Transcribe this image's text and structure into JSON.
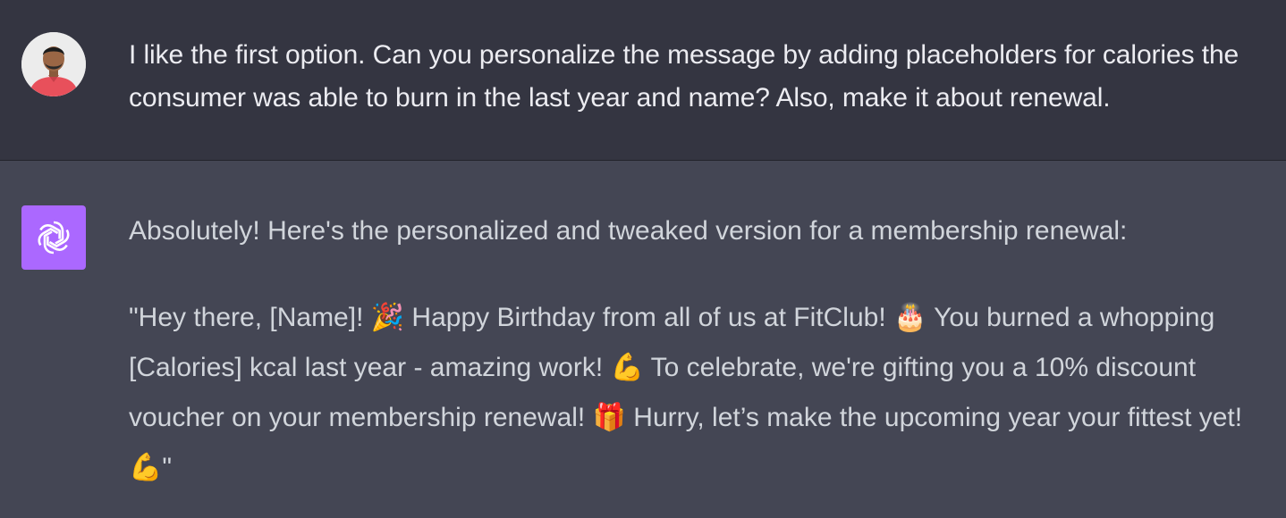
{
  "user_message": {
    "avatar_icon": "user-avatar-photo",
    "text": "I like the first option. Can you personalize the message by adding placeholders for calories the consumer was able to burn in the last year and name? Also, make it about renewal."
  },
  "assistant_message": {
    "avatar_icon": "openai-logo-icon",
    "avatar_color": "#ab68ff",
    "intro": "Absolutely! Here's the personalized and tweaked version for a membership renewal:",
    "body": "\"Hey there, [Name]! 🎉 Happy Birthday from all of us at FitClub! 🎂 You burned a whopping [Calories] kcal last year - amazing work! 💪 To celebrate, we're gifting you a 10% discount voucher on your membership renewal! 🎁 Hurry, let’s make the upcoming year your fittest yet! 💪\""
  },
  "colors": {
    "user_bg": "#343541",
    "assistant_bg": "#444654",
    "text": "#d1d5db"
  }
}
